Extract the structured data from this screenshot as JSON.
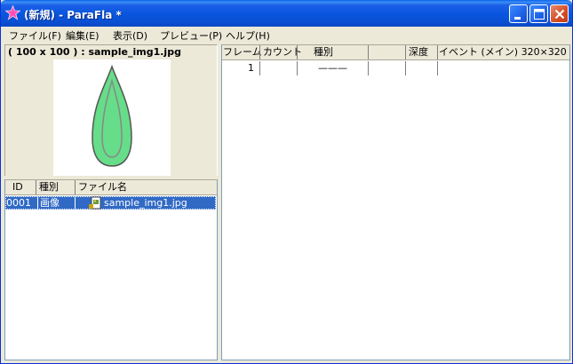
{
  "window": {
    "title": "(新規) - ParaFla *",
    "app_icon": "star-icon",
    "buttons": [
      "minimize-icon",
      "maximize-icon",
      "close-icon"
    ]
  },
  "menu": [
    {
      "label": "ファイル(F)"
    },
    {
      "label": "編集(E)"
    },
    {
      "label": "表示(D)"
    },
    {
      "label": "プレビュー(P)"
    },
    {
      "label": "ヘルプ(H)"
    }
  ],
  "preview": {
    "label": "( 100 x 100 ) : sample_img1.jpg",
    "image_semantic": "green-leaf-drop-image"
  },
  "assets": {
    "columns": [
      "ID",
      "種別",
      "ファイル名"
    ],
    "rows": [
      {
        "id": "0001",
        "type": "画像",
        "filename": "sample_img1.jpg",
        "icon": "image-file-icon"
      }
    ]
  },
  "timeline": {
    "columns": [
      "フレーム",
      "カウント",
      "種別",
      "",
      "深度",
      "イベント (メイン) 320×320"
    ],
    "rows": [
      {
        "frame": "1",
        "count": "",
        "type_mark": "———",
        "blank": "",
        "depth": "",
        "event": ""
      }
    ]
  },
  "colors": {
    "titlebar": "#0a4fd2",
    "selection": "#316ac5",
    "window_bg": "#ece9d8",
    "leaf_fill": "#66dd88"
  }
}
